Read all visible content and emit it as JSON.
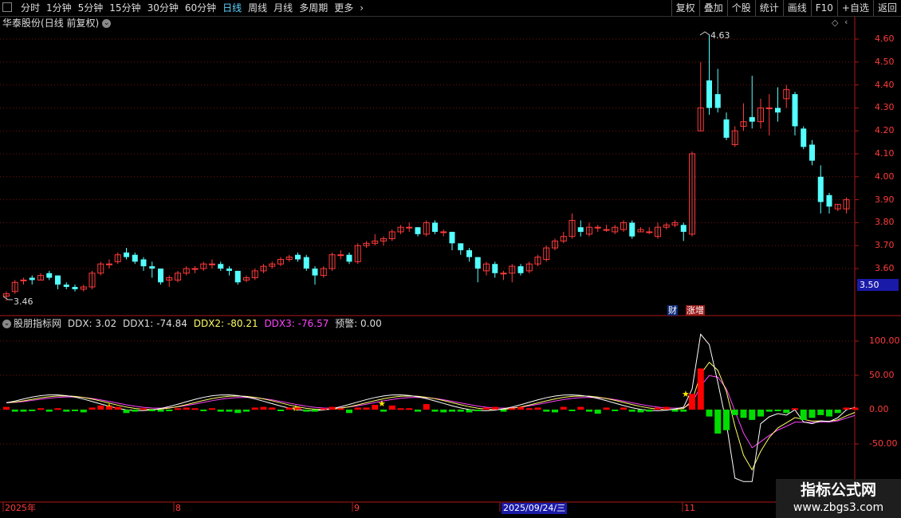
{
  "toolbar": {
    "period_tabs": [
      "分时",
      "1分钟",
      "5分钟",
      "15分钟",
      "30分钟",
      "60分钟",
      "日线",
      "周线",
      "月线",
      "多周期",
      "更多"
    ],
    "active_tab": "日线",
    "more_arrow": "›",
    "right_tools": [
      "复权",
      "叠加",
      "个股",
      "统计",
      "画线",
      "F10",
      "+自选",
      "返回"
    ]
  },
  "header": {
    "stock_name": "华泰股份",
    "mode": "(日线 前复权)"
  },
  "price_axis": {
    "ticks": [
      "4.60",
      "4.50",
      "4.40",
      "4.30",
      "4.20",
      "4.10",
      "4.00",
      "3.90",
      "3.80",
      "3.70",
      "3.60"
    ],
    "current_price": "3.50",
    "high_label": "4.63",
    "low_label": "3.46"
  },
  "tags": {
    "cai": "财",
    "zhangzeng": "涨增"
  },
  "indicator": {
    "name": "股朋指标网",
    "ddx_label": "DDX:",
    "ddx": "3.02",
    "ddx1_label": "DDX1:",
    "ddx1": "-74.84",
    "ddx2_label": "DDX2:",
    "ddx2": "-80.21",
    "ddx3_label": "DDX3:",
    "ddx3": "-76.57",
    "warn_label": "预警:",
    "warn": "0.00",
    "axis_ticks": [
      "100.00",
      "50.00",
      "0.00",
      "-50.00"
    ]
  },
  "date_axis": {
    "labels": [
      "2025年",
      "8",
      "9",
      "2025/09/24/三",
      "11"
    ]
  },
  "watermark": {
    "line1": "指标公式网",
    "line2": "www.zbgs3.com"
  },
  "colors": {
    "up": "#ff3b3b",
    "down": "#54ffff",
    "ddx1": "#ffffff",
    "ddx2": "#ffff66",
    "ddx3": "#ff44ff",
    "bar_up": "#ff0000",
    "bar_down": "#00dd00",
    "grid": "#7a1010",
    "axis": "#b01818"
  },
  "chart_data": {
    "type": "candlestick",
    "ylim": [
      3.46,
      4.63
    ],
    "candles": [
      [
        3.48,
        3.49,
        3.5,
        3.46
      ],
      [
        3.5,
        3.54,
        3.55,
        3.49
      ],
      [
        3.55,
        3.55,
        3.56,
        3.53
      ],
      [
        3.56,
        3.55,
        3.57,
        3.53
      ],
      [
        3.55,
        3.57,
        3.58,
        3.55
      ],
      [
        3.58,
        3.56,
        3.59,
        3.55
      ],
      [
        3.57,
        3.53,
        3.57,
        3.51
      ],
      [
        3.53,
        3.52,
        3.54,
        3.51
      ],
      [
        3.52,
        3.51,
        3.53,
        3.5
      ],
      [
        3.51,
        3.52,
        3.53,
        3.5
      ],
      [
        3.52,
        3.58,
        3.59,
        3.51
      ],
      [
        3.58,
        3.62,
        3.63,
        3.57
      ],
      [
        3.62,
        3.62,
        3.64,
        3.6
      ],
      [
        3.63,
        3.66,
        3.67,
        3.62
      ],
      [
        3.67,
        3.65,
        3.69,
        3.64
      ],
      [
        3.66,
        3.63,
        3.67,
        3.62
      ],
      [
        3.64,
        3.61,
        3.65,
        3.59
      ],
      [
        3.61,
        3.6,
        3.63,
        3.56
      ],
      [
        3.6,
        3.54,
        3.6,
        3.53
      ],
      [
        3.55,
        3.56,
        3.57,
        3.52
      ],
      [
        3.55,
        3.58,
        3.59,
        3.54
      ],
      [
        3.58,
        3.6,
        3.61,
        3.57
      ],
      [
        3.6,
        3.6,
        3.61,
        3.58
      ],
      [
        3.6,
        3.62,
        3.63,
        3.59
      ],
      [
        3.62,
        3.62,
        3.64,
        3.6
      ],
      [
        3.62,
        3.6,
        3.63,
        3.59
      ],
      [
        3.6,
        3.59,
        3.61,
        3.57
      ],
      [
        3.59,
        3.54,
        3.59,
        3.53
      ],
      [
        3.55,
        3.56,
        3.57,
        3.54
      ],
      [
        3.56,
        3.59,
        3.6,
        3.55
      ],
      [
        3.59,
        3.61,
        3.62,
        3.58
      ],
      [
        3.61,
        3.62,
        3.63,
        3.6
      ],
      [
        3.62,
        3.64,
        3.65,
        3.61
      ],
      [
        3.64,
        3.65,
        3.66,
        3.63
      ],
      [
        3.66,
        3.64,
        3.67,
        3.63
      ],
      [
        3.65,
        3.6,
        3.66,
        3.59
      ],
      [
        3.6,
        3.57,
        3.61,
        3.53
      ],
      [
        3.57,
        3.6,
        3.61,
        3.56
      ],
      [
        3.6,
        3.66,
        3.67,
        3.59
      ],
      [
        3.66,
        3.66,
        3.68,
        3.64
      ],
      [
        3.66,
        3.63,
        3.67,
        3.62
      ],
      [
        3.63,
        3.7,
        3.71,
        3.62
      ],
      [
        3.7,
        3.71,
        3.72,
        3.69
      ],
      [
        3.71,
        3.72,
        3.75,
        3.7
      ],
      [
        3.72,
        3.73,
        3.74,
        3.7
      ],
      [
        3.73,
        3.76,
        3.77,
        3.72
      ],
      [
        3.76,
        3.78,
        3.79,
        3.75
      ],
      [
        3.78,
        3.78,
        3.8,
        3.76
      ],
      [
        3.78,
        3.75,
        3.78,
        3.74
      ],
      [
        3.75,
        3.8,
        3.81,
        3.74
      ],
      [
        3.8,
        3.76,
        3.81,
        3.75
      ],
      [
        3.76,
        3.76,
        3.77,
        3.74
      ],
      [
        3.76,
        3.71,
        3.76,
        3.68
      ],
      [
        3.71,
        3.68,
        3.71,
        3.66
      ],
      [
        3.68,
        3.65,
        3.69,
        3.63
      ],
      [
        3.65,
        3.6,
        3.65,
        3.54
      ],
      [
        3.59,
        3.62,
        3.63,
        3.57
      ],
      [
        3.62,
        3.58,
        3.63,
        3.56
      ],
      [
        3.58,
        3.58,
        3.59,
        3.55
      ],
      [
        3.58,
        3.61,
        3.62,
        3.54
      ],
      [
        3.61,
        3.58,
        3.62,
        3.57
      ],
      [
        3.59,
        3.62,
        3.63,
        3.58
      ],
      [
        3.62,
        3.65,
        3.66,
        3.61
      ],
      [
        3.64,
        3.69,
        3.7,
        3.63
      ],
      [
        3.69,
        3.72,
        3.73,
        3.68
      ],
      [
        3.72,
        3.74,
        3.76,
        3.71
      ],
      [
        3.74,
        3.81,
        3.84,
        3.73
      ],
      [
        3.78,
        3.76,
        3.81,
        3.74
      ],
      [
        3.75,
        3.78,
        3.8,
        3.74
      ],
      [
        3.78,
        3.78,
        3.79,
        3.76
      ],
      [
        3.77,
        3.77,
        3.79,
        3.76
      ],
      [
        3.76,
        3.78,
        3.79,
        3.75
      ],
      [
        3.77,
        3.8,
        3.81,
        3.76
      ],
      [
        3.8,
        3.74,
        3.81,
        3.73
      ],
      [
        3.76,
        3.77,
        3.78,
        3.76
      ],
      [
        3.76,
        3.76,
        3.78,
        3.75
      ],
      [
        3.74,
        3.78,
        3.8,
        3.73
      ],
      [
        3.78,
        3.79,
        3.8,
        3.77
      ],
      [
        3.79,
        3.8,
        3.81,
        3.78
      ],
      [
        3.79,
        3.76,
        3.8,
        3.72
      ],
      [
        3.75,
        4.1,
        4.11,
        3.74
      ],
      [
        4.2,
        4.3,
        4.5,
        4.2
      ],
      [
        4.42,
        4.3,
        4.62,
        4.27
      ],
      [
        4.36,
        4.3,
        4.47,
        4.28
      ],
      [
        4.25,
        4.17,
        4.28,
        4.16
      ],
      [
        4.14,
        4.2,
        4.22,
        4.13
      ],
      [
        4.22,
        4.24,
        4.32,
        4.2
      ],
      [
        4.26,
        4.24,
        4.44,
        4.21
      ],
      [
        4.24,
        4.3,
        4.34,
        4.21
      ],
      [
        4.3,
        4.3,
        4.36,
        4.18
      ],
      [
        4.3,
        4.28,
        4.39,
        4.24
      ],
      [
        4.34,
        4.38,
        4.4,
        4.3
      ],
      [
        4.36,
        4.22,
        4.37,
        4.18
      ],
      [
        4.21,
        4.13,
        4.22,
        4.12
      ],
      [
        4.14,
        4.07,
        4.16,
        4.05
      ],
      [
        4.0,
        3.89,
        4.05,
        3.84
      ],
      [
        3.92,
        3.87,
        3.93,
        3.84
      ],
      [
        3.86,
        3.88,
        3.88,
        3.85
      ],
      [
        3.86,
        3.9,
        3.91,
        3.84
      ]
    ],
    "ddx_bars": [
      4,
      -3,
      -3,
      -2,
      2,
      -3,
      2,
      -3,
      -2,
      -4,
      3,
      6,
      5,
      4,
      -5,
      -3,
      2,
      -2,
      -3,
      -2,
      2,
      3,
      2,
      -2,
      2,
      -3,
      -3,
      -5,
      -3,
      3,
      4,
      3,
      -2,
      3,
      3,
      -3,
      -3,
      2,
      4,
      2,
      -5,
      3,
      3,
      7,
      -3,
      6,
      2,
      2,
      -3,
      8,
      -3,
      -4,
      -3,
      -3,
      -4,
      -2,
      3,
      4,
      -3,
      2,
      4,
      2,
      3,
      -3,
      -4,
      4,
      -2,
      4,
      -3,
      -6,
      3,
      -2,
      3,
      -3,
      -4,
      -3,
      3,
      4,
      -3,
      -3,
      23,
      60,
      -10,
      -35,
      -30,
      -8,
      -12,
      -15,
      -10,
      -3,
      -2,
      -5,
      2,
      -15,
      -12,
      -8,
      -10,
      -5,
      3,
      3
    ],
    "ddx_scale_ylim": [
      -100,
      125
    ]
  }
}
